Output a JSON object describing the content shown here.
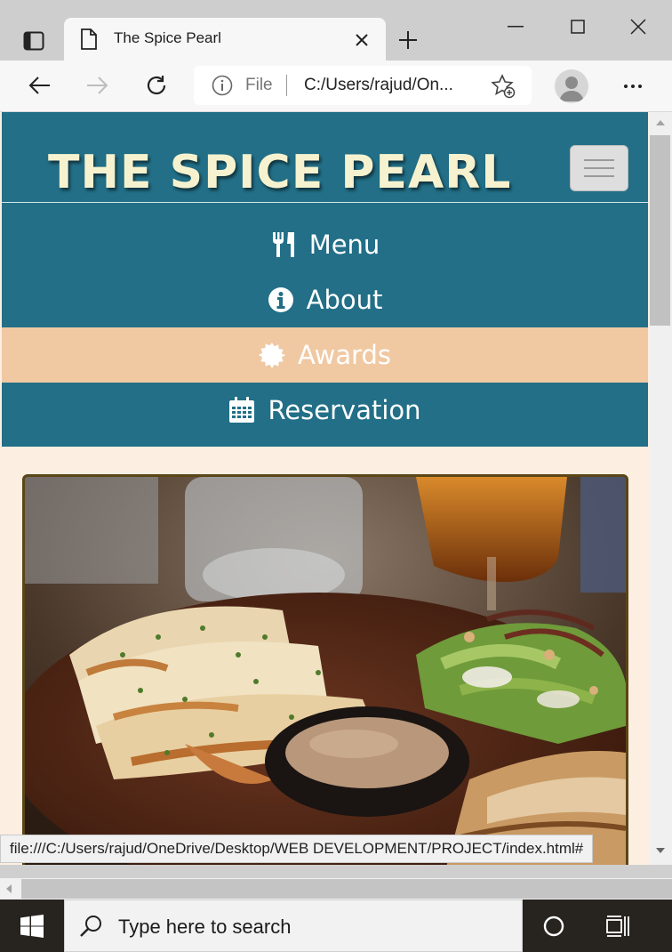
{
  "browser": {
    "tab_title": "The Spice Pearl",
    "file_label": "File",
    "url": "C:/Users/rajud/On...",
    "status_url": "file:///C:/Users/rajud/OneDrive/Desktop/WEB DEVELOPMENT/PROJECT/index.html#"
  },
  "site": {
    "brand": "THE SPICE PEARL",
    "nav": [
      {
        "label": "Menu",
        "icon": "utensils-icon",
        "active": false
      },
      {
        "label": "About",
        "icon": "info-circle-icon",
        "active": false
      },
      {
        "label": "Awards",
        "icon": "certificate-icon",
        "active": true
      },
      {
        "label": "Reservation",
        "icon": "calendar-icon",
        "active": false
      }
    ],
    "hero_image": "grilled-seafood-salad-platter"
  },
  "taskbar": {
    "search_placeholder": "Type here to search"
  },
  "colors": {
    "header": "#226f87",
    "active_nav": "#f0c8a2",
    "page_bg": "#fdeee2",
    "brand_text": "#f6f2cf",
    "hero_border": "#5a4616"
  }
}
